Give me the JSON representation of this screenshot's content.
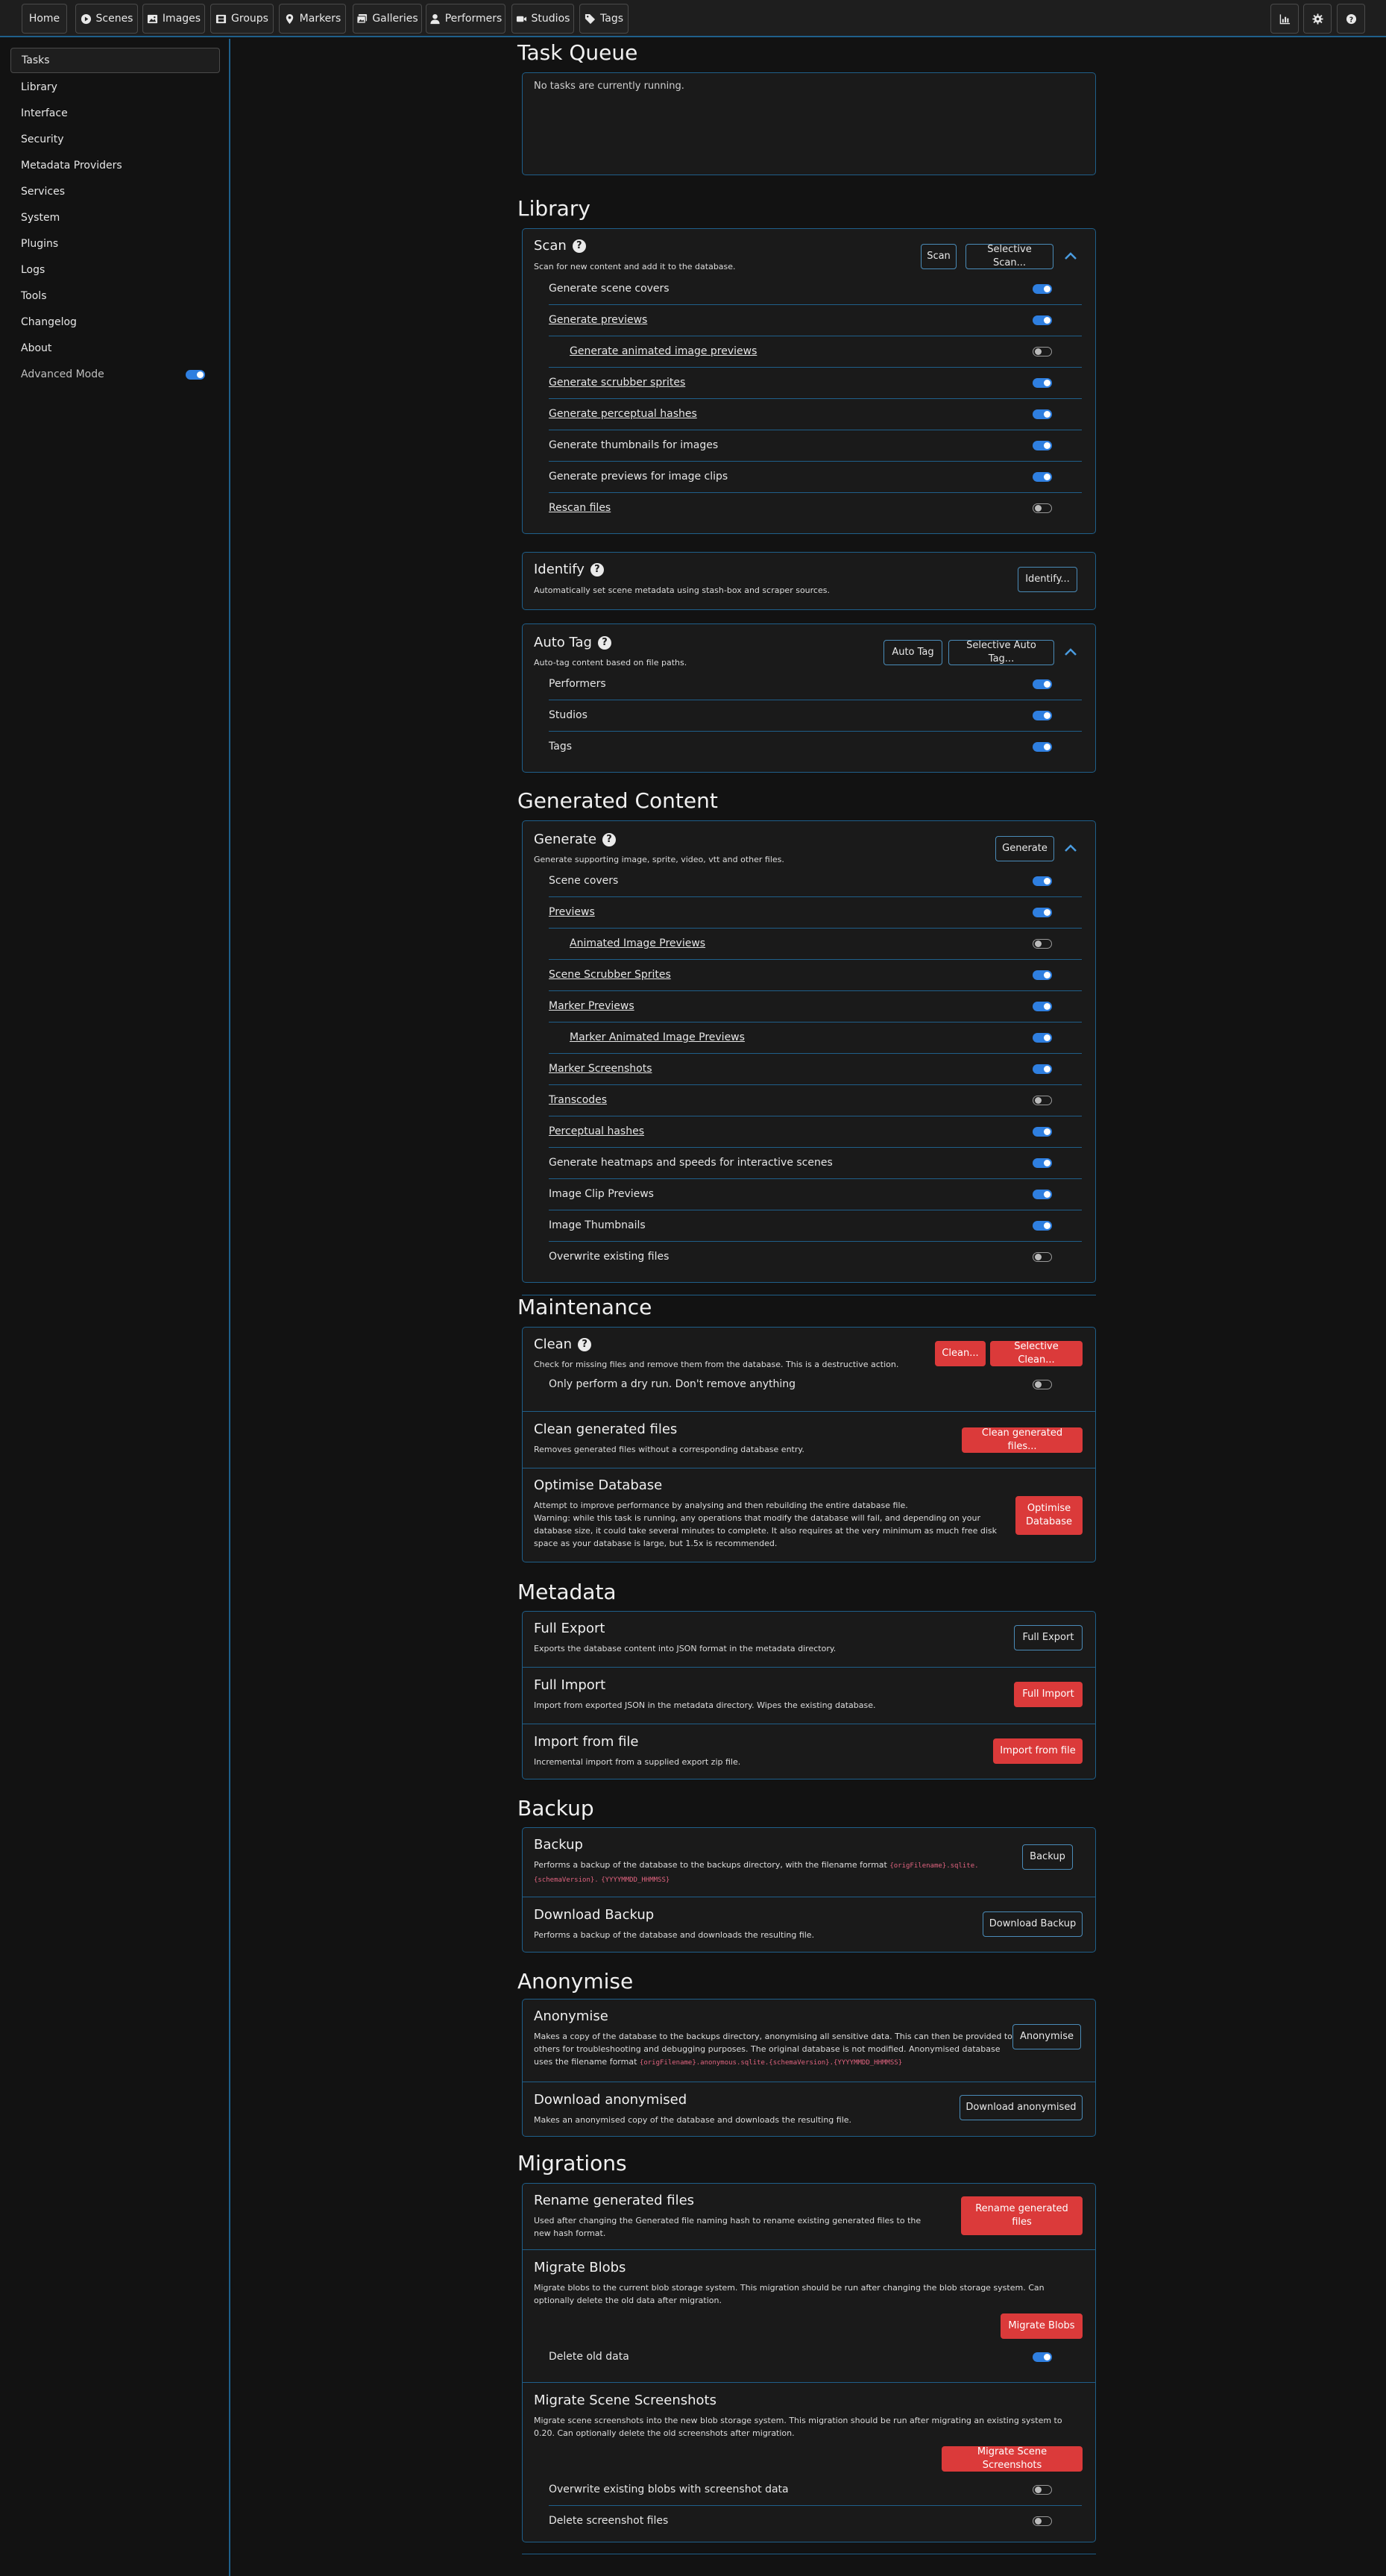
{
  "nav": {
    "items": [
      {
        "label": "Home",
        "icon": ""
      },
      {
        "label": "Scenes",
        "icon": "play-circle-icon"
      },
      {
        "label": "Images",
        "icon": "image-icon"
      },
      {
        "label": "Groups",
        "icon": "film-icon"
      },
      {
        "label": "Markers",
        "icon": "map-marker-icon"
      },
      {
        "label": "Galleries",
        "icon": "images-icon"
      },
      {
        "label": "Performers",
        "icon": "user-icon"
      },
      {
        "label": "Studios",
        "icon": "video-icon"
      },
      {
        "label": "Tags",
        "icon": "tag-icon"
      }
    ],
    "right_icons": [
      "chart-icon",
      "gear-icon",
      "help-icon"
    ]
  },
  "sidebar": {
    "items": [
      "Tasks",
      "Library",
      "Interface",
      "Security",
      "Metadata Providers",
      "Services",
      "System",
      "Plugins",
      "Logs",
      "Tools",
      "Changelog",
      "About"
    ],
    "active": "Tasks",
    "advanced_mode_label": "Advanced Mode",
    "advanced_mode_on": true
  },
  "task_queue": {
    "title": "Task Queue",
    "empty_text": "No tasks are currently running."
  },
  "library": {
    "title": "Library",
    "scan": {
      "title": "Scan",
      "desc": "Scan for new content and add it to the database.",
      "btn_scan": "Scan",
      "btn_selective": "Selective Scan...",
      "options": [
        {
          "label": "Generate scene covers",
          "on": true
        },
        {
          "label": "Generate previews",
          "on": true
        },
        {
          "label": "Generate animated image previews",
          "on": false
        },
        {
          "label": "Generate scrubber sprites",
          "on": true
        },
        {
          "label": "Generate perceptual hashes",
          "on": true
        },
        {
          "label": "Generate thumbnails for images",
          "on": true
        },
        {
          "label": "Generate previews for image clips",
          "on": true
        },
        {
          "label": "Rescan files",
          "on": false
        }
      ]
    },
    "identify": {
      "title": "Identify",
      "desc": "Automatically set scene metadata using stash-box and scraper sources.",
      "btn": "Identify..."
    },
    "auto_tag": {
      "title": "Auto Tag",
      "desc": "Auto-tag content based on file paths.",
      "btn": "Auto Tag",
      "btn_selective": "Selective Auto Tag...",
      "options": [
        {
          "label": "Performers",
          "on": true
        },
        {
          "label": "Studios",
          "on": true
        },
        {
          "label": "Tags",
          "on": true
        }
      ]
    }
  },
  "generated": {
    "title": "Generated Content",
    "generate": {
      "title": "Generate",
      "desc": "Generate supporting image, sprite, video, vtt and other files.",
      "btn": "Generate",
      "options": [
        {
          "label": "Scene covers",
          "on": true
        },
        {
          "label": "Previews",
          "on": true
        },
        {
          "label": "Animated Image Previews",
          "on": false
        },
        {
          "label": "Scene Scrubber Sprites",
          "on": true
        },
        {
          "label": "Marker Previews",
          "on": true
        },
        {
          "label": "Marker Animated Image Previews",
          "on": true
        },
        {
          "label": "Marker Screenshots",
          "on": true
        },
        {
          "label": "Transcodes",
          "on": false
        },
        {
          "label": "Perceptual hashes",
          "on": true
        },
        {
          "label": "Generate heatmaps and speeds for interactive scenes",
          "on": true
        },
        {
          "label": "Image Clip Previews",
          "on": true
        },
        {
          "label": "Image Thumbnails",
          "on": true
        },
        {
          "label": "Overwrite existing files",
          "on": false
        }
      ]
    }
  },
  "maintenance": {
    "title": "Maintenance",
    "clean": {
      "title": "Clean",
      "desc": "Check for missing files and remove them from the database. This is a destructive action.",
      "btn": "Clean...",
      "btn_selective": "Selective Clean...",
      "dry_run_label": "Only perform a dry run. Don't remove anything",
      "dry_run_on": false
    },
    "clean_generated": {
      "title": "Clean generated files",
      "desc": "Removes generated files without a corresponding database entry.",
      "btn": "Clean generated files..."
    },
    "optimise": {
      "title": "Optimise Database",
      "desc1": "Attempt to improve performance by analysing and then rebuilding the entire database file.",
      "desc2": "Warning: while this task is running, any operations that modify the database will fail, and depending on your database size, it could take several minutes to complete. It also requires at the very minimum as much free disk space as your database is large, but 1.5x is recommended.",
      "btn": "Optimise Database"
    }
  },
  "metadata": {
    "title": "Metadata",
    "full_export": {
      "title": "Full Export",
      "desc": "Exports the database content into JSON format in the metadata directory.",
      "btn": "Full Export"
    },
    "full_import": {
      "title": "Full Import",
      "desc": "Import from exported JSON in the metadata directory. Wipes the existing database.",
      "btn": "Full Import"
    },
    "import_file": {
      "title": "Import from file",
      "desc": "Incremental import from a supplied export zip file.",
      "btn": "Import from file"
    }
  },
  "backup": {
    "title": "Backup",
    "backup": {
      "title": "Backup",
      "desc_pre": "Performs a backup of the database to the backups directory, with the filename format",
      "code1": "{origFilename}.sqlite.{schemaVersion}.",
      "code2": "{YYYYMMDD_HHMMSS}",
      "btn": "Backup"
    },
    "download": {
      "title": "Download Backup",
      "desc": "Performs a backup of the database and downloads the resulting file.",
      "btn": "Download Backup"
    }
  },
  "anonymise": {
    "title": "Anonymise",
    "anonymise": {
      "title": "Anonymise",
      "desc": "Makes a copy of the database to the backups directory, anonymising all sensitive data. This can then be provided to others for troubleshooting and debugging purposes. The original database is not modified. Anonymised database uses the filename format",
      "code": "{origFilename}.anonymous.sqlite.{schemaVersion}.{YYYYMMDD_HHMMSS}",
      "btn": "Anonymise"
    },
    "download": {
      "title": "Download anonymised",
      "desc": "Makes an anonymised copy of the database and downloads the resulting file.",
      "btn": "Download anonymised"
    }
  },
  "migrations": {
    "title": "Migrations",
    "rename": {
      "title": "Rename generated files",
      "desc": "Used after changing the Generated file naming hash to rename existing generated files to the new hash format.",
      "btn": "Rename generated files"
    },
    "blobs": {
      "title": "Migrate Blobs",
      "desc": "Migrate blobs to the current blob storage system. This migration should be run after changing the blob storage system. Can optionally delete the old data after migration.",
      "btn": "Migrate Blobs",
      "delete_label": "Delete old data",
      "delete_on": true
    },
    "screenshots": {
      "title": "Migrate Scene Screenshots",
      "desc": "Migrate scene screenshots into the new blob storage system. This migration should be run after migrating an existing system to 0.20. Can optionally delete the old screenshots after migration.",
      "btn": "Migrate Scene Screenshots",
      "overwrite_label": "Overwrite existing blobs with screenshot data",
      "overwrite_on": false,
      "delete_label": "Delete screenshot files",
      "delete_on": false
    }
  },
  "colors": {
    "accent_border": "#1f5f8a",
    "danger": "#db3a3a",
    "toggle_on": "#2f7fe0",
    "background": "#121212"
  }
}
